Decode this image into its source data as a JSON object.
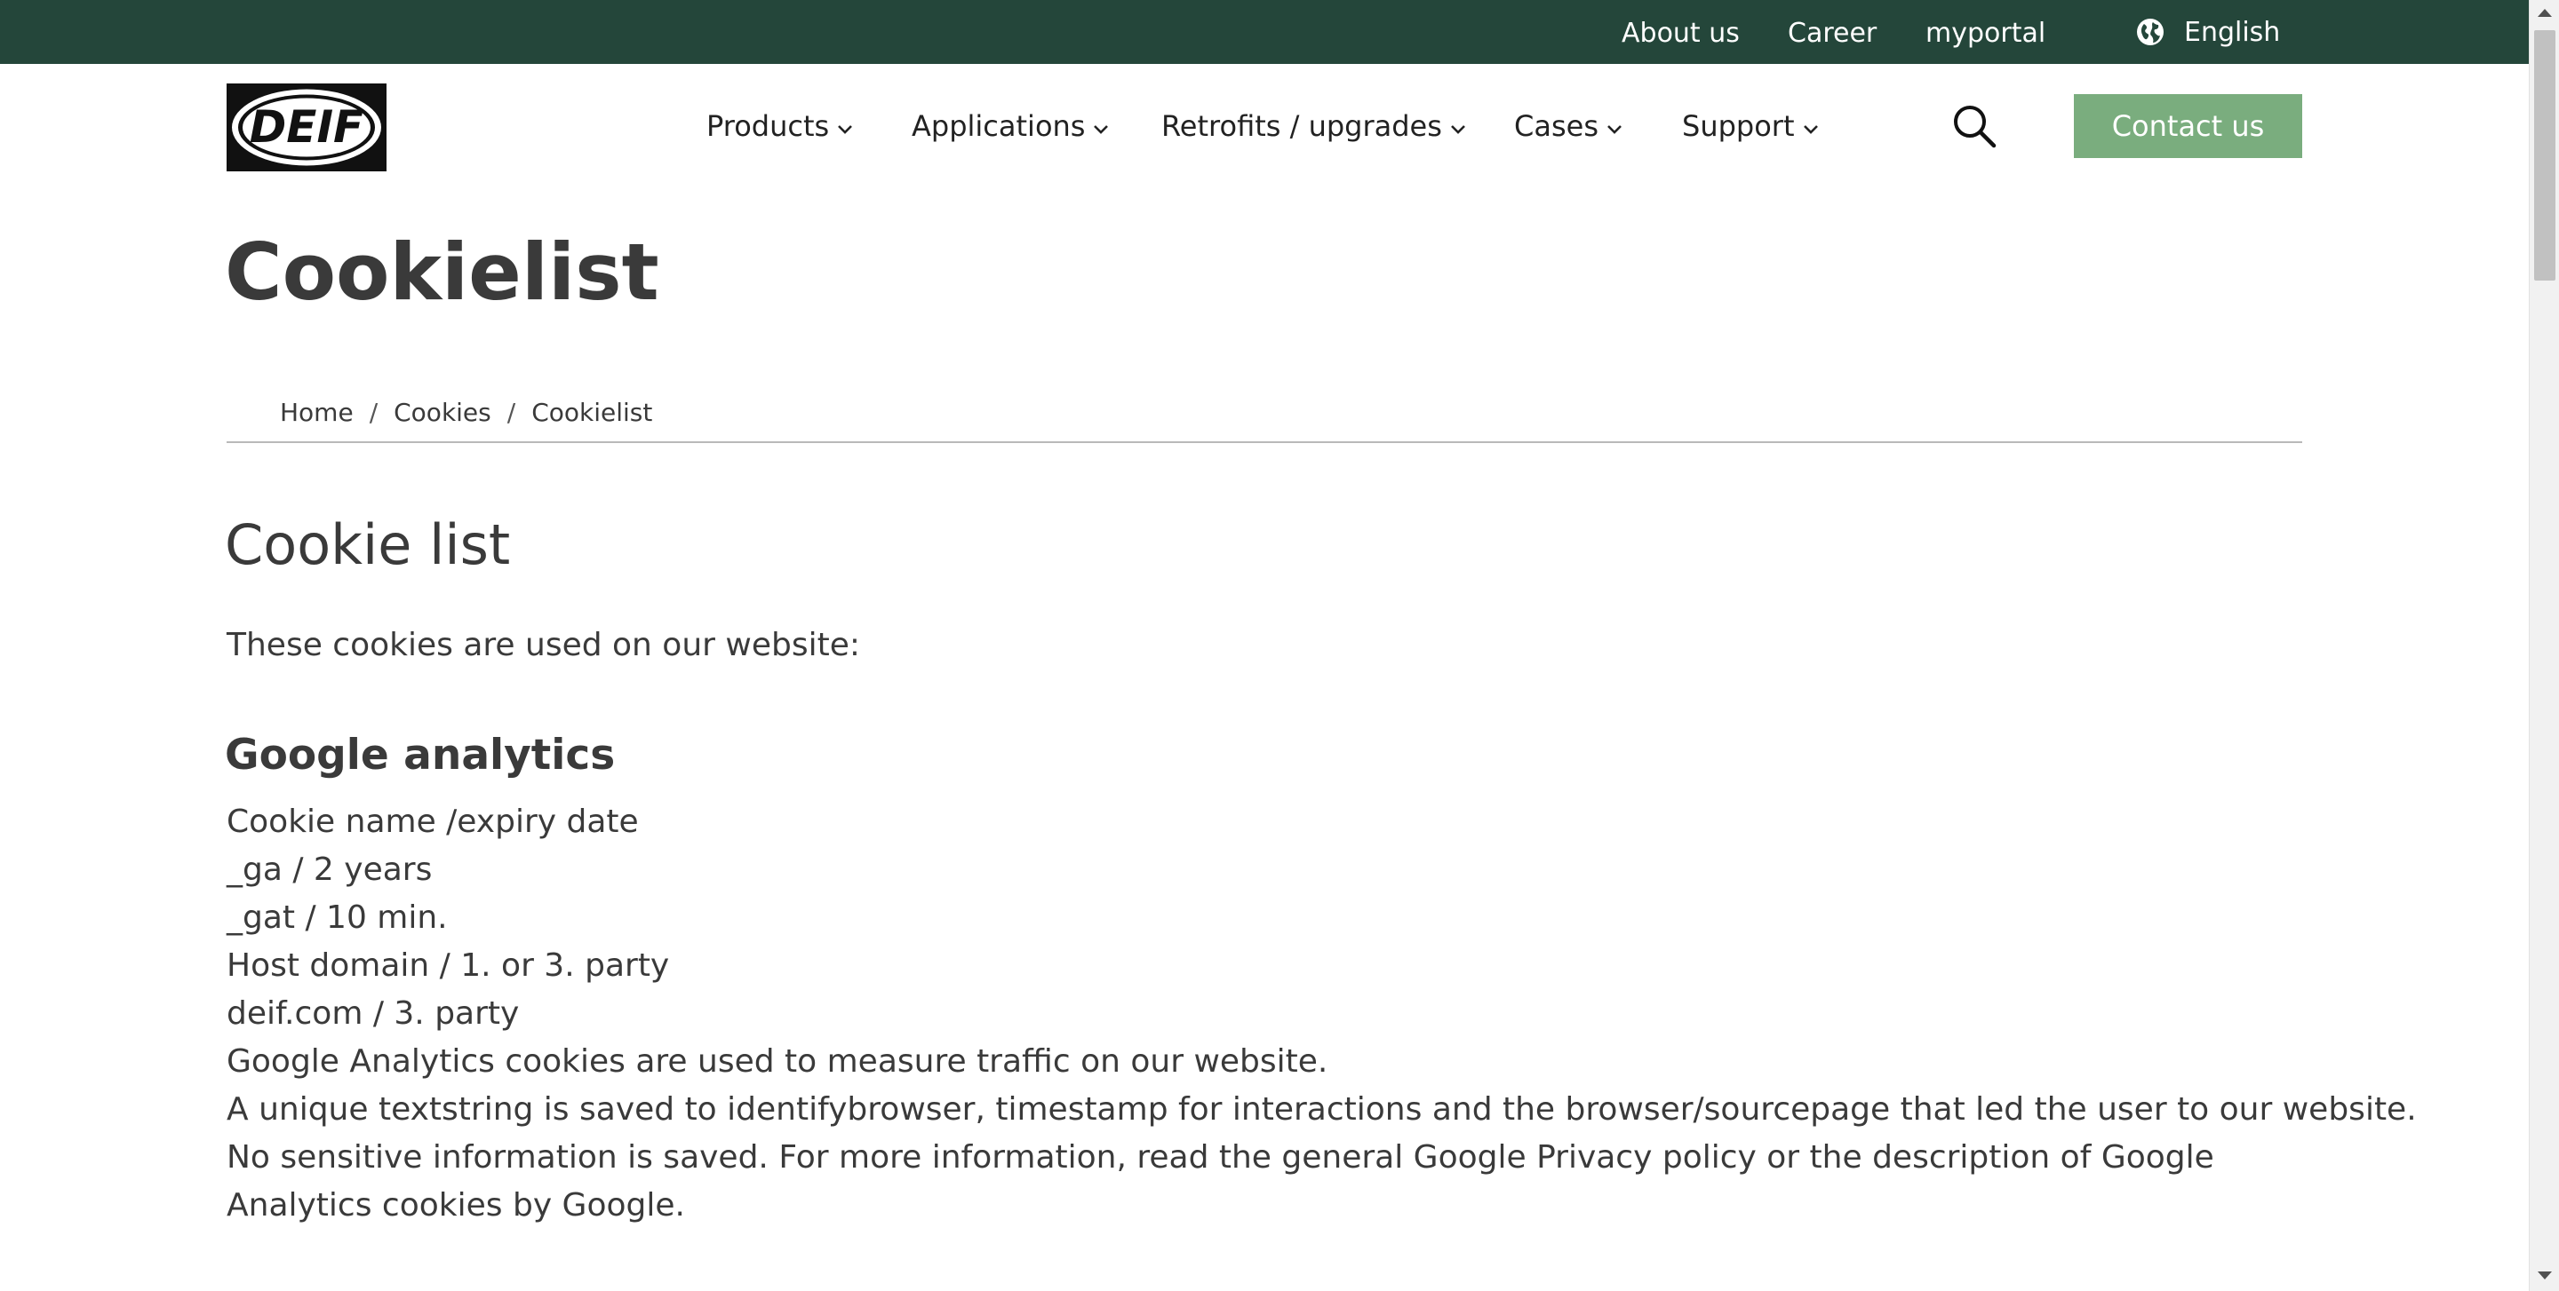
{
  "topbar": {
    "links": [
      {
        "label": "About us"
      },
      {
        "label": "Career"
      },
      {
        "label": "myportal"
      }
    ],
    "language": {
      "label": "English",
      "icon": "globe-icon"
    }
  },
  "header": {
    "logo_text": "DEIF",
    "nav": [
      {
        "label": "Products"
      },
      {
        "label": "Applications"
      },
      {
        "label": "Retrofits / upgrades"
      },
      {
        "label": "Cases"
      },
      {
        "label": "Support"
      }
    ],
    "search_icon": "search-icon",
    "contact_label": "Contact us"
  },
  "page": {
    "title": "Cookielist",
    "breadcrumb": [
      "Home",
      "Cookies",
      "Cookielist"
    ]
  },
  "content": {
    "section_title": "Cookie list",
    "intro": "These cookies are used on our website:",
    "google_analytics": {
      "heading": "Google analytics",
      "lines": [
        "Cookie name /expiry date",
        "_ga / 2 years",
        "_gat / 10 min.",
        "Host domain / 1. or 3. party",
        "deif.com / 3. party",
        "Google Analytics cookies are used to measure traffic on our website.",
        "A unique textstring is saved to identifybrowser, timestamp for interactions and the browser/sourcepage that led the user to our website.",
        "No sensitive information is saved. For more information, read the general Google Privacy policy or the description of Google Analytics cookies by Google."
      ]
    }
  },
  "colors": {
    "topbar_bg": "#24463a",
    "contact_bg": "#7aad7e",
    "text": "#3a3a3a"
  }
}
